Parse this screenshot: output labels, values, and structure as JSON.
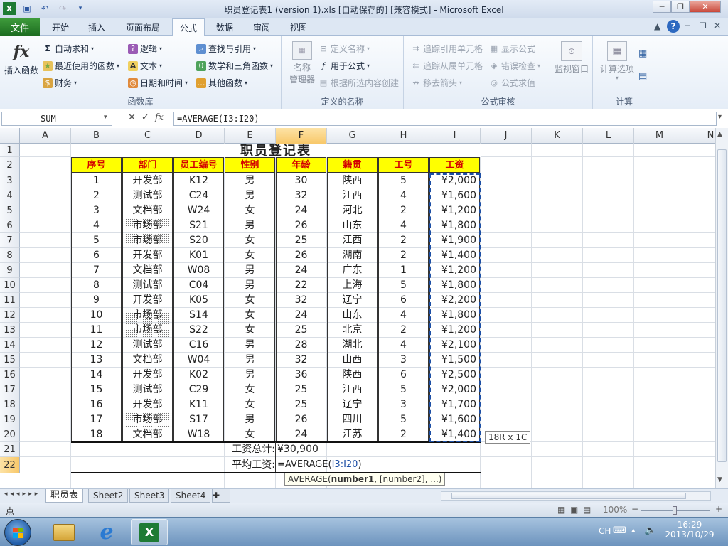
{
  "window": {
    "title": "职员登记表1 (version 1).xls [自动保存的] [兼容模式] - Microsoft Excel",
    "min": "─",
    "max": "❐",
    "close": "✕"
  },
  "tabs": {
    "file": "文件",
    "items": [
      "开始",
      "插入",
      "页面布局",
      "公式",
      "数据",
      "审阅",
      "视图"
    ]
  },
  "ribbon": {
    "lib": {
      "insert_function": "插入函数",
      "autosum": "自动求和",
      "recent": "最近使用的函数",
      "finance": "财务",
      "logical": "逻辑",
      "text": "文本",
      "datetime": "日期和时间",
      "lookup": "查找与引用",
      "math": "数学和三角函数",
      "other": "其他函数",
      "label": "函数库"
    },
    "names": {
      "name_manager": "名称",
      "name_manager2": "管理器",
      "define": "定义名称",
      "use_in": "用于公式",
      "create": "根据所选内容创建",
      "label": "定义的名称"
    },
    "audit": {
      "trace_prec": "追踪引用单元格",
      "trace_dep": "追踪从属单元格",
      "remove": "移去箭头",
      "show": "显示公式",
      "error": "错误检查",
      "eval": "公式求值",
      "watch": "监视窗口",
      "label": "公式审核"
    },
    "calc": {
      "options": "计算选项",
      "label": "计算"
    }
  },
  "formula_bar": {
    "name_box": "SUM",
    "formula": "=AVERAGE(I3:I20)",
    "cancel": "✕",
    "enter": "✓",
    "fx": "fx"
  },
  "columns": [
    "A",
    "B",
    "C",
    "D",
    "E",
    "F",
    "G",
    "H",
    "I",
    "J",
    "K",
    "L",
    "M",
    "N"
  ],
  "rows": [
    "1",
    "2",
    "3",
    "4",
    "5",
    "6",
    "7",
    "8",
    "9",
    "10",
    "11",
    "12",
    "13",
    "14",
    "15",
    "16",
    "17",
    "18",
    "19",
    "20",
    "21",
    "22"
  ],
  "sheet": {
    "title": "职员登记表",
    "headers": [
      "序号",
      "部门",
      "员工编号",
      "性别",
      "年龄",
      "籍贯",
      "工号",
      "工资"
    ],
    "data": [
      [
        "1",
        "开发部",
        "K12",
        "男",
        "30",
        "陕西",
        "5",
        "¥2,000"
      ],
      [
        "2",
        "测试部",
        "C24",
        "男",
        "32",
        "江西",
        "4",
        "¥1,600"
      ],
      [
        "3",
        "文档部",
        "W24",
        "女",
        "24",
        "河北",
        "2",
        "¥1,200"
      ],
      [
        "4",
        "市场部",
        "S21",
        "男",
        "26",
        "山东",
        "4",
        "¥1,800"
      ],
      [
        "5",
        "市场部",
        "S20",
        "女",
        "25",
        "江西",
        "2",
        "¥1,900"
      ],
      [
        "6",
        "开发部",
        "K01",
        "女",
        "26",
        "湖南",
        "2",
        "¥1,400"
      ],
      [
        "7",
        "文档部",
        "W08",
        "男",
        "24",
        "广东",
        "1",
        "¥1,200"
      ],
      [
        "8",
        "测试部",
        "C04",
        "男",
        "22",
        "上海",
        "5",
        "¥1,800"
      ],
      [
        "9",
        "开发部",
        "K05",
        "女",
        "32",
        "辽宁",
        "6",
        "¥2,200"
      ],
      [
        "10",
        "市场部",
        "S14",
        "女",
        "24",
        "山东",
        "4",
        "¥1,800"
      ],
      [
        "11",
        "市场部",
        "S22",
        "女",
        "25",
        "北京",
        "2",
        "¥1,200"
      ],
      [
        "12",
        "测试部",
        "C16",
        "男",
        "28",
        "湖北",
        "4",
        "¥2,100"
      ],
      [
        "13",
        "文档部",
        "W04",
        "男",
        "32",
        "山西",
        "3",
        "¥1,500"
      ],
      [
        "14",
        "开发部",
        "K02",
        "男",
        "36",
        "陕西",
        "6",
        "¥2,500"
      ],
      [
        "15",
        "测试部",
        "C29",
        "女",
        "25",
        "江西",
        "5",
        "¥2,000"
      ],
      [
        "16",
        "开发部",
        "K11",
        "女",
        "25",
        "辽宁",
        "3",
        "¥1,700"
      ],
      [
        "17",
        "市场部",
        "S17",
        "男",
        "26",
        "四川",
        "5",
        "¥1,600"
      ],
      [
        "18",
        "文档部",
        "W18",
        "女",
        "24",
        "江苏",
        "2",
        "¥1,400"
      ]
    ],
    "total_label": "工资总计:",
    "total_value": "¥30,900",
    "avg_label": "平均工资:",
    "avg_formula_pre": "=AVERAGE(",
    "avg_formula_ref": "I3:I20",
    "avg_formula_post": ")",
    "range_tip": "18R x 1C",
    "func_tip_name": "AVERAGE(",
    "func_tip_arg1": "number1",
    "func_tip_rest": ", [number2], ...)"
  },
  "sheets": [
    "职员表",
    "Sheet2",
    "Sheet3",
    "Sheet4"
  ],
  "status": {
    "mode": "点",
    "zoom": "100%",
    "minus": "−",
    "plus": "+"
  },
  "taskbar": {
    "time": "16:29",
    "date": "2013/10/29",
    "lang": "CH"
  },
  "colors": {
    "header_fill": "#ffff00",
    "header_text": "#d40000",
    "file_tab": "#2b7d2a",
    "selection": "#f8c86a"
  }
}
